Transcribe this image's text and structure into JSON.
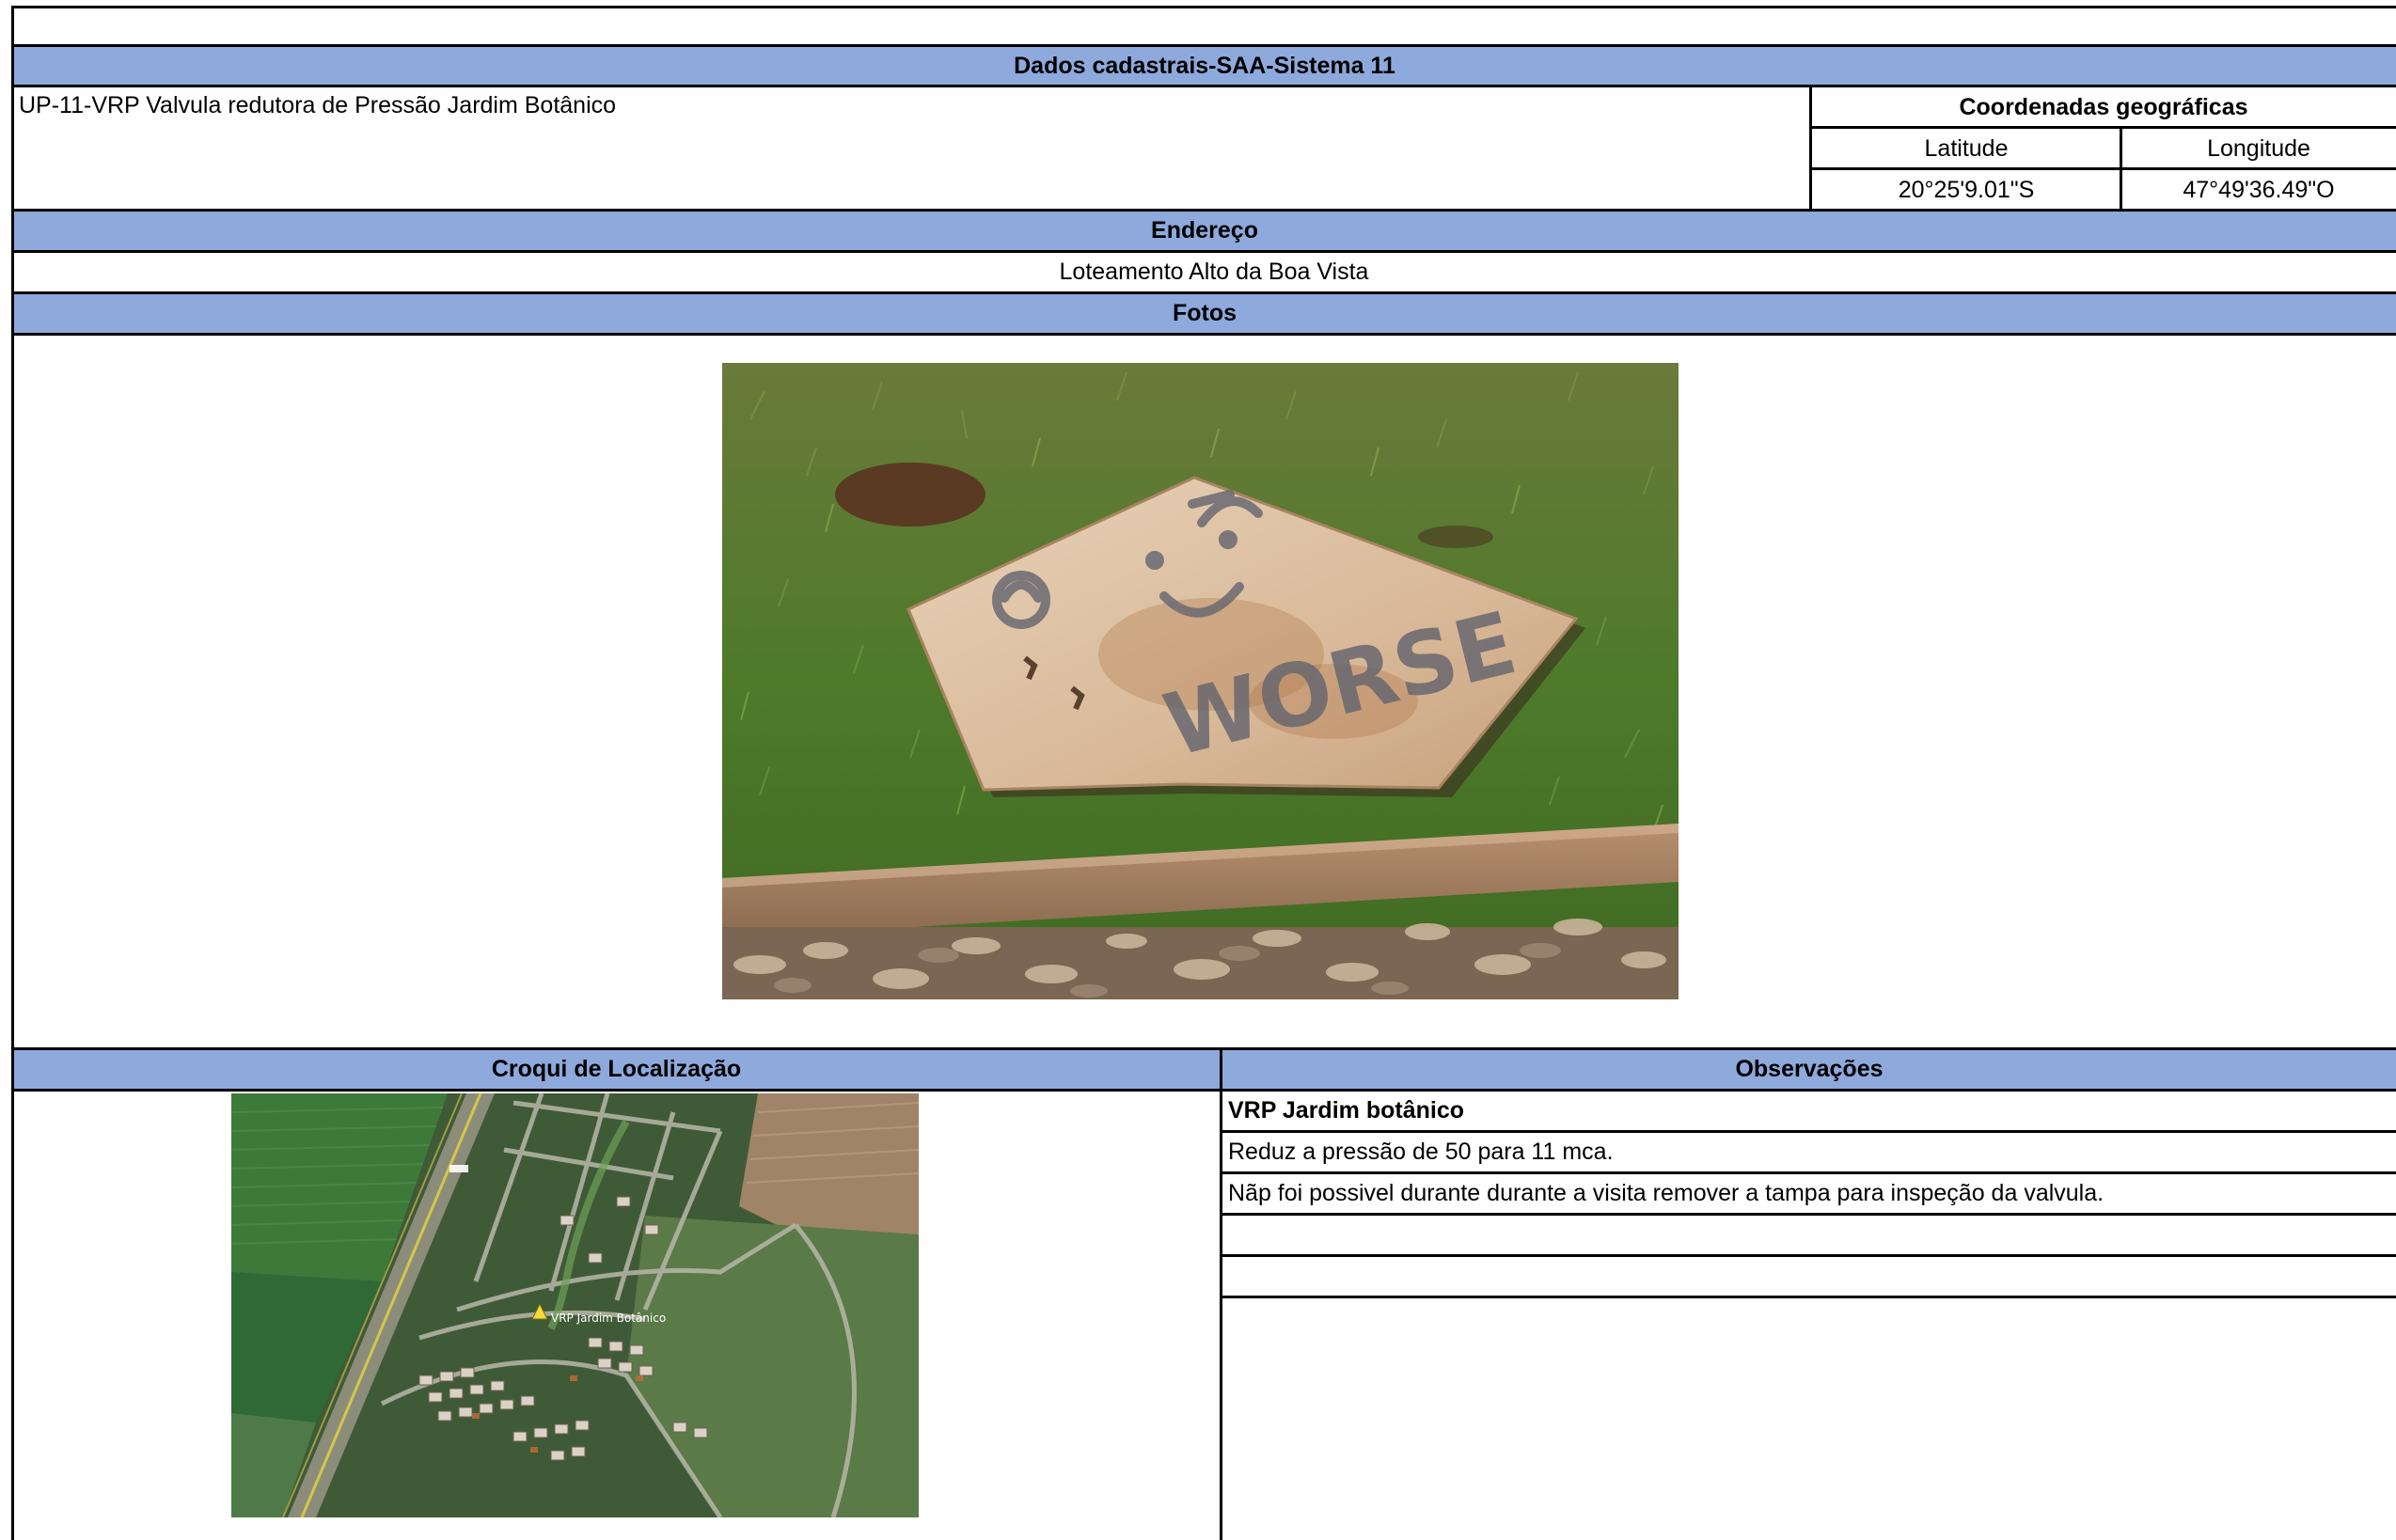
{
  "sheet": {
    "title_bar": "Dados cadastrais-SAA-Sistema 11",
    "unit_name": "UP-11-VRP Valvula redutora de Pressão Jardim Botânico",
    "coordinates": {
      "header": "Coordenadas geográficas",
      "latitude_label": "Latitude",
      "longitude_label": "Longitude",
      "latitude_value": "20°25'9.01\"S",
      "longitude_value": "47°49'36.49\"O"
    },
    "address": {
      "header": "Endereço",
      "value": "Loteamento Alto da Boa Vista"
    },
    "photos": {
      "header": "Fotos",
      "photo_graffiti_text": "WORSE"
    },
    "location_sketch": {
      "header": "Croqui de Localização",
      "map_label": "VRP Jardim Botânico"
    },
    "observations": {
      "header": "Observações",
      "lines": [
        "VRP Jardim botânico",
        "Reduz a pressão de 50 para 11 mca.",
        "Nãp foi possivel durante durante a visita remover a tampa para inspeção da valvula.",
        "",
        ""
      ]
    }
  },
  "colors": {
    "header_fill": "#8ea9db",
    "grid_lines": "#000000"
  }
}
